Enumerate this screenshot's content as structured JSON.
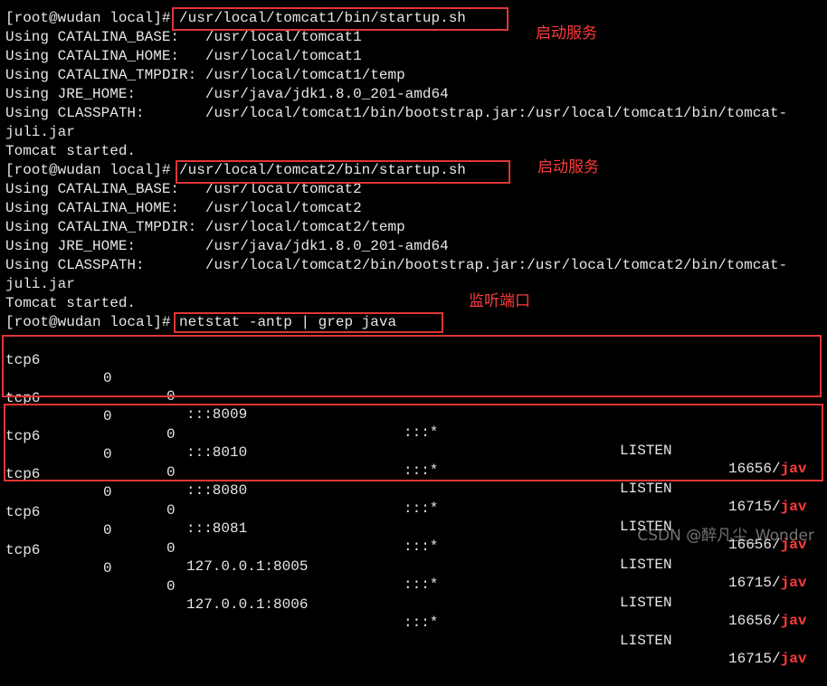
{
  "terminal": {
    "lines": [
      {
        "prompt": "[root@wudan local]#",
        "cmd": " /usr/local/tomcat1/bin/startup.sh"
      },
      "Using CATALINA_BASE:   /usr/local/tomcat1",
      "Using CATALINA_HOME:   /usr/local/tomcat1",
      "Using CATALINA_TMPDIR: /usr/local/tomcat1/temp",
      "Using JRE_HOME:        /usr/java/jdk1.8.0_201-amd64",
      "Using CLASSPATH:       /usr/local/tomcat1/bin/bootstrap.jar:/usr/local/tomcat1/bin/tomcat-",
      "juli.jar",
      "Tomcat started.",
      {
        "prompt": "[root@wudan local]#",
        "cmd": " /usr/local/tomcat2/bin/startup.sh"
      },
      "Using CATALINA_BASE:   /usr/local/tomcat2",
      "Using CATALINA_HOME:   /usr/local/tomcat2",
      "Using CATALINA_TMPDIR: /usr/local/tomcat2/temp",
      "Using JRE_HOME:        /usr/java/jdk1.8.0_201-amd64",
      "Using CLASSPATH:       /usr/local/tomcat2/bin/bootstrap.jar:/usr/local/tomcat2/bin/tomcat-",
      "juli.jar",
      "Tomcat started.",
      {
        "prompt": "[root@wudan local]#",
        "cmd": " netstat -antp | grep java"
      }
    ],
    "netstat_rows": [
      {
        "proto": "tcp6",
        "recv": "0",
        "send": "0",
        "local": ":::8009",
        "foreign": ":::*",
        "state": "LISTEN",
        "pid": "16656/",
        "prog": "jav"
      },
      {
        "proto": "tcp6",
        "recv": "0",
        "send": "0",
        "local": ":::8010",
        "foreign": ":::*",
        "state": "LISTEN",
        "pid": "16715/",
        "prog": "jav"
      },
      {
        "proto": "tcp6",
        "recv": "0",
        "send": "0",
        "local": ":::8080",
        "foreign": ":::*",
        "state": "LISTEN",
        "pid": "16656/",
        "prog": "jav"
      },
      {
        "proto": "tcp6",
        "recv": "0",
        "send": "0",
        "local": ":::8081",
        "foreign": ":::*",
        "state": "LISTEN",
        "pid": "16715/",
        "prog": "jav"
      },
      {
        "proto": "tcp6",
        "recv": "0",
        "send": "0",
        "local": "127.0.0.1:8005",
        "foreign": ":::*",
        "state": "LISTEN",
        "pid": "16656/",
        "prog": "jav"
      },
      {
        "proto": "tcp6",
        "recv": "0",
        "send": "0",
        "local": "127.0.0.1:8006",
        "foreign": ":::*",
        "state": "LISTEN",
        "pid": "16715/",
        "prog": "jav"
      }
    ]
  },
  "annotations": {
    "start_service_1": "启动服务",
    "start_service_2": "启动服务",
    "listen_port": "监听端口"
  },
  "watermark": "CSDN @醉凡尘_Wonder",
  "colors": {
    "background": "#000000",
    "text": "#e6e6e6",
    "highlight": "#ff3b3b",
    "box": "#e03535"
  }
}
